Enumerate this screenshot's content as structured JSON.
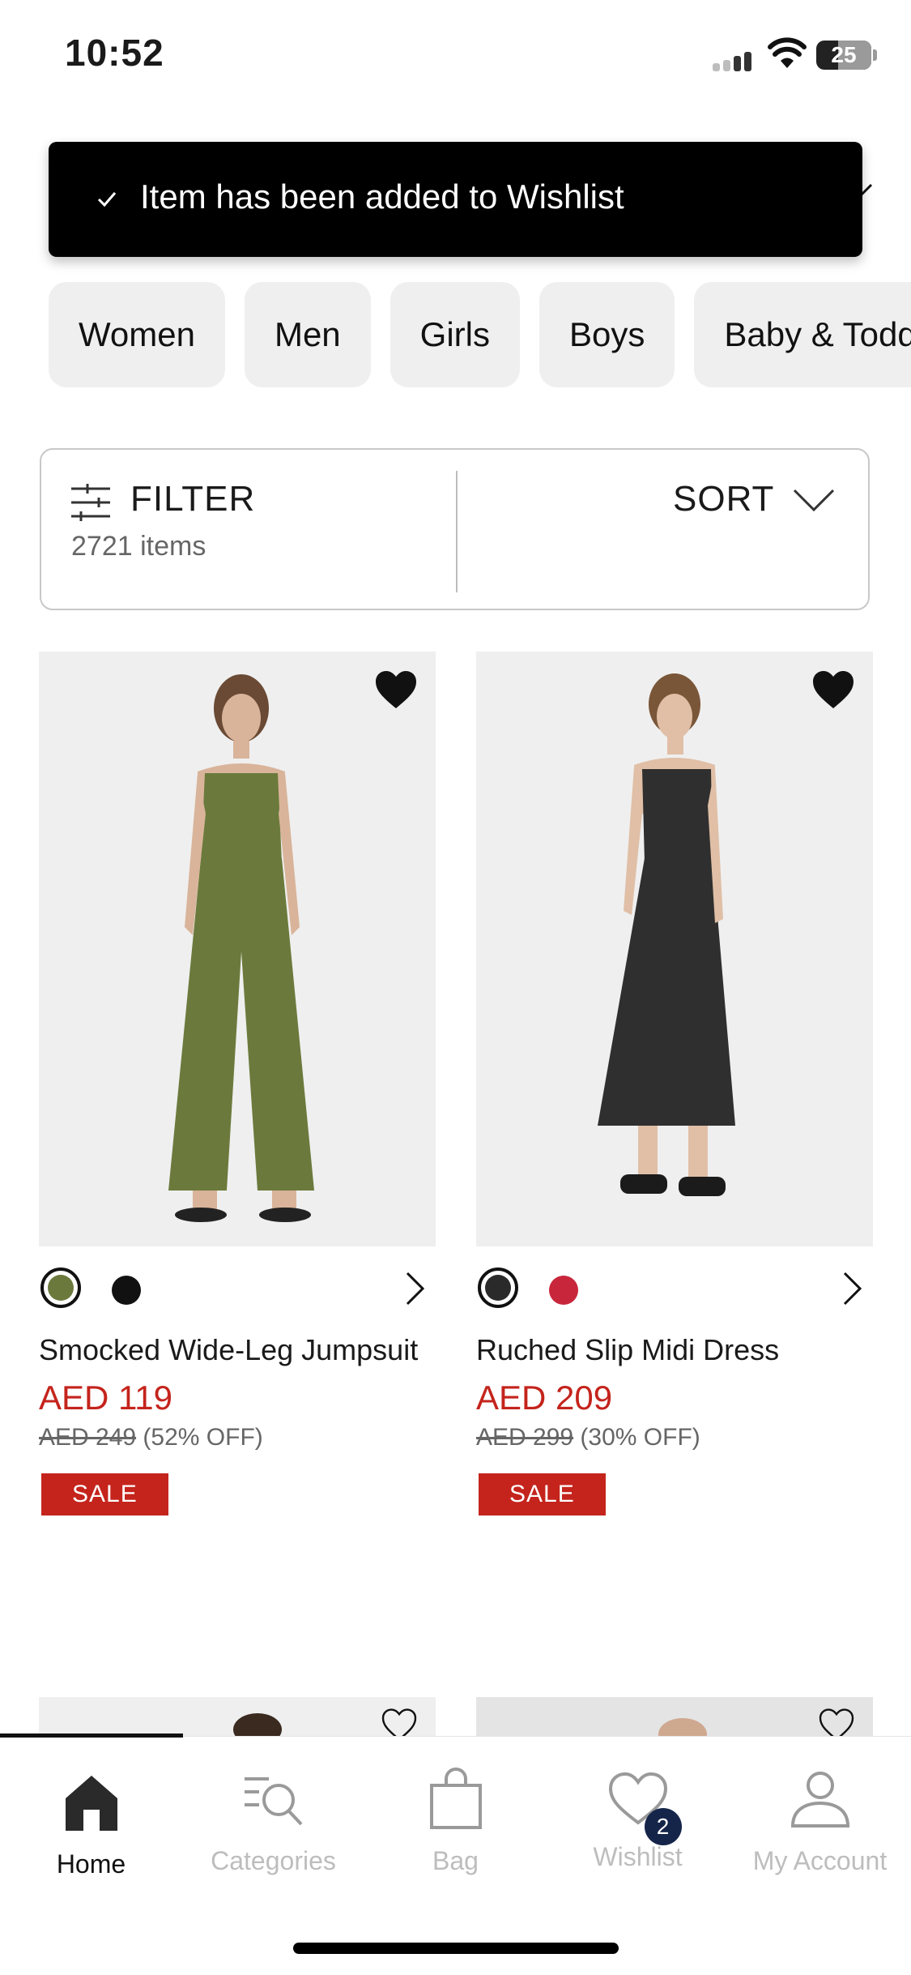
{
  "status_bar": {
    "time": "10:52",
    "battery": "25"
  },
  "toast": {
    "message": "Item has been added to Wishlist"
  },
  "categories": [
    "Women",
    "Men",
    "Girls",
    "Boys",
    "Baby & Toddler"
  ],
  "filter_bar": {
    "filter_label": "FILTER",
    "item_count": "2721 items",
    "sort_label": "SORT"
  },
  "products": [
    {
      "name": "Smocked Wide-Leg Jumpsuit",
      "price": "AED 119",
      "original_price": "AED 249",
      "discount": "(52% OFF)",
      "badge": "SALE",
      "wishlisted": true,
      "swatches": [
        "#6b7a3c",
        "#111111"
      ]
    },
    {
      "name": "Ruched Slip Midi Dress",
      "price": "AED 209",
      "original_price": "AED 299",
      "discount": "(30% OFF)",
      "badge": "SALE",
      "wishlisted": true,
      "swatches": [
        "#2a2a2a",
        "#c8263b"
      ]
    }
  ],
  "bottom_nav": {
    "items": [
      {
        "label": "Home",
        "icon": "home-icon",
        "active": true
      },
      {
        "label": "Categories",
        "icon": "categories-search-icon",
        "active": false
      },
      {
        "label": "Bag",
        "icon": "bag-icon",
        "active": false
      },
      {
        "label": "Wishlist",
        "icon": "heart-icon",
        "active": false,
        "badge": "2"
      },
      {
        "label": "My Account",
        "icon": "account-icon",
        "active": false
      }
    ]
  },
  "colors": {
    "sale_red": "#c4241c",
    "toast_bg": "#000000",
    "badge_navy": "#15254a"
  }
}
